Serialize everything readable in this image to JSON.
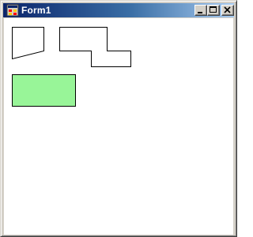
{
  "window": {
    "title": "Form1"
  },
  "titlebar": {
    "icon": "form-app-icon",
    "buttons": [
      {
        "name": "minimize",
        "icon": "minimize-icon"
      },
      {
        "name": "maximize",
        "icon": "maximize-icon"
      },
      {
        "name": "close",
        "icon": "close-icon"
      }
    ]
  },
  "canvas": {
    "shapes": [
      {
        "name": "trapezoid-shape",
        "type": "polygon",
        "stroke": "#000000",
        "fill": "none"
      },
      {
        "name": "step-polygon-shape",
        "type": "polygon",
        "stroke": "#000000",
        "fill": "none"
      },
      {
        "name": "green-rectangle-shape",
        "type": "rect",
        "stroke": "#000000",
        "fill": "#98f598"
      }
    ]
  },
  "colors": {
    "titlebar_start": "#0a246a",
    "titlebar_end": "#a6caf0",
    "window_face": "#d4d0c8",
    "client_background": "#ffffff",
    "rectangle_fill": "#98f598"
  }
}
